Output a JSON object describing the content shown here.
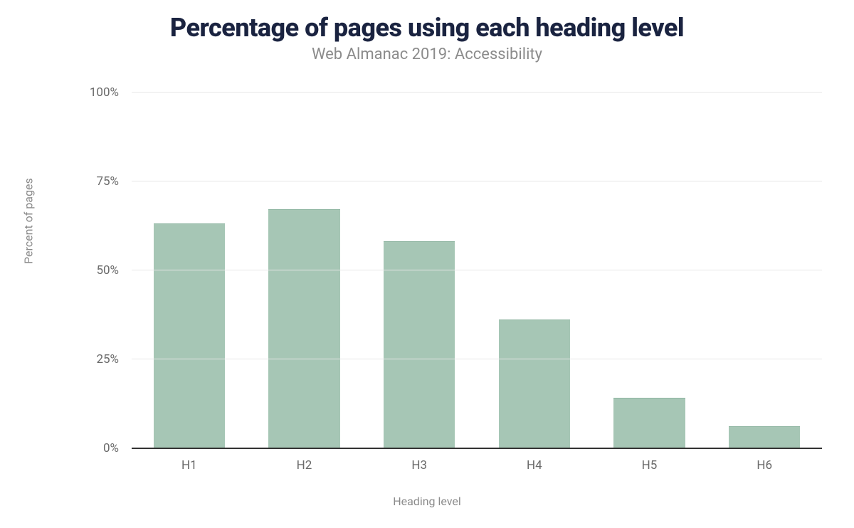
{
  "chart_data": {
    "type": "bar",
    "title": "Percentage of pages using each heading level",
    "subtitle": "Web Almanac 2019: Accessibility",
    "xlabel": "Heading level",
    "ylabel": "Percent of pages",
    "categories": [
      "H1",
      "H2",
      "H3",
      "H4",
      "H5",
      "H6"
    ],
    "values": [
      63,
      67,
      58,
      36,
      14,
      6
    ],
    "ylim": [
      0,
      100
    ],
    "y_ticks": [
      0,
      25,
      50,
      75,
      100
    ],
    "y_tick_labels": [
      "0%",
      "25%",
      "50%",
      "75%",
      "100%"
    ],
    "bar_color": "#a6c6b5",
    "grid": true
  }
}
